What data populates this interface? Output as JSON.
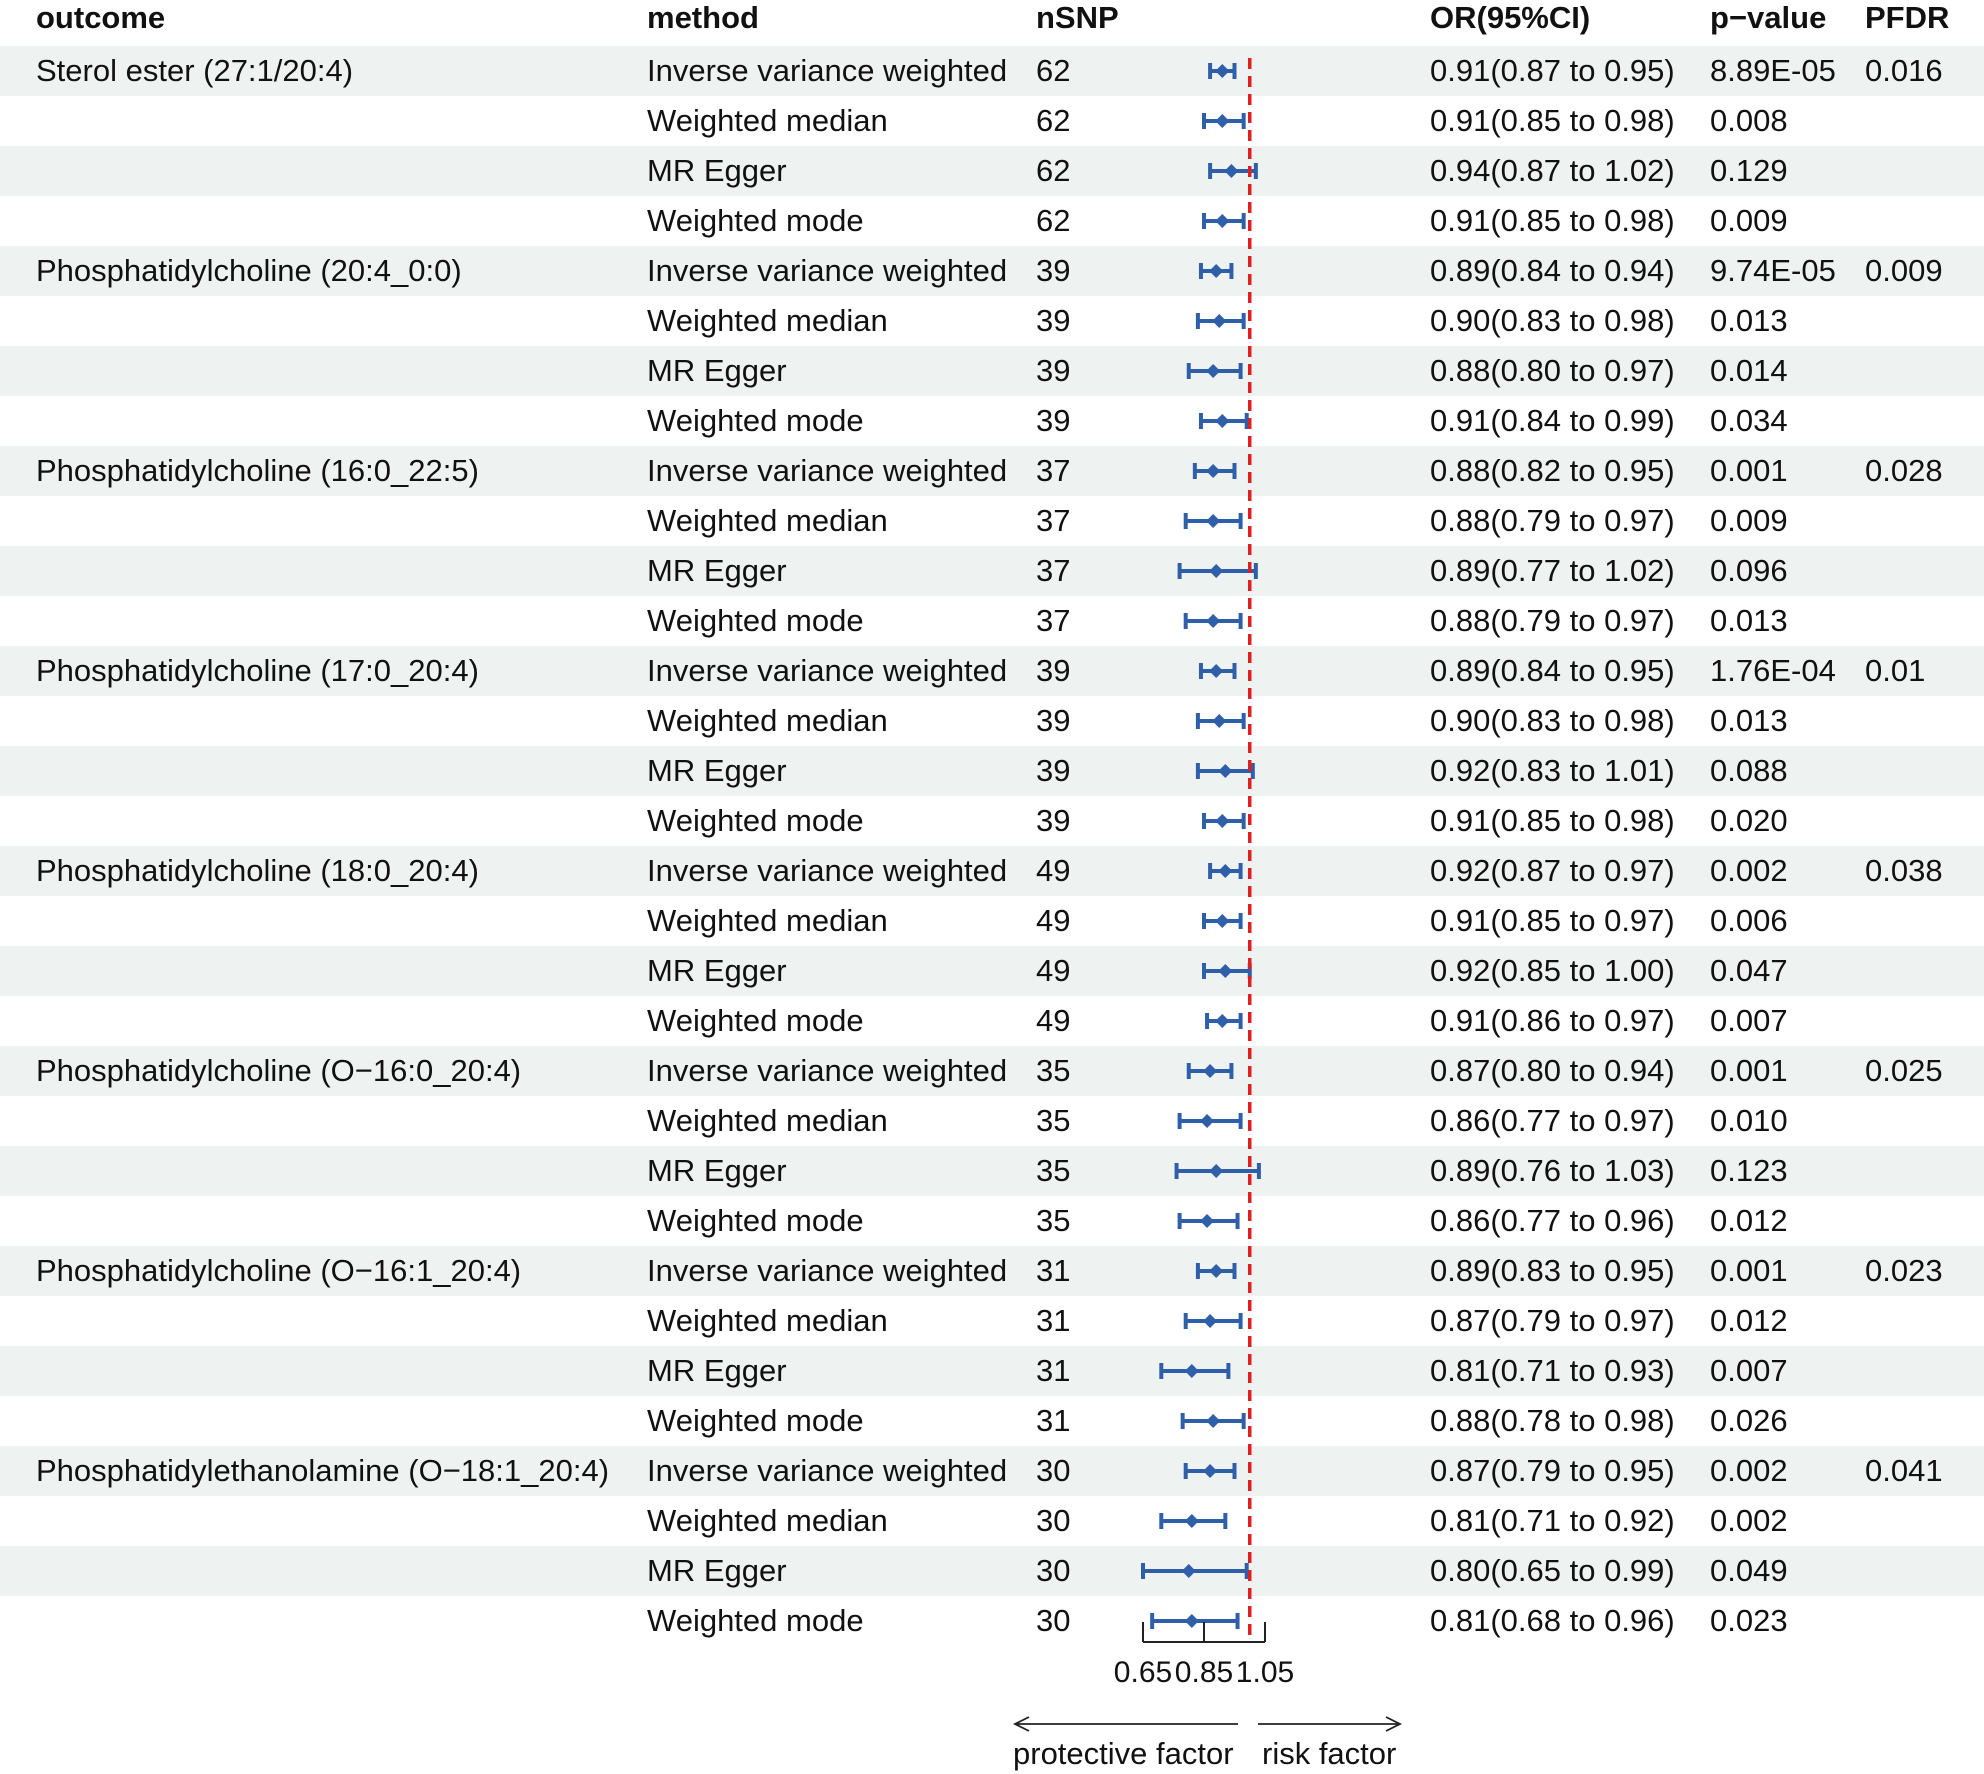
{
  "headers": {
    "outcome": "outcome",
    "method": "method",
    "nsnp": "nSNP",
    "or": "OR(95%CI)",
    "pvalue": "p−value",
    "pfdr": "PFDR"
  },
  "rows": [
    {
      "outcome": "Sterol ester (27:1/20:4)",
      "method": "Inverse variance weighted",
      "nsnp": "62",
      "or_text": "0.91(0.87 to 0.95)",
      "p": "8.89E-05",
      "pfdr": "0.016"
    },
    {
      "outcome": "",
      "method": "Weighted median",
      "nsnp": "62",
      "or_text": "0.91(0.85 to 0.98)",
      "p": "0.008",
      "pfdr": ""
    },
    {
      "outcome": "",
      "method": "MR Egger",
      "nsnp": "62",
      "or_text": "0.94(0.87 to 1.02)",
      "p": "0.129",
      "pfdr": ""
    },
    {
      "outcome": "",
      "method": "Weighted mode",
      "nsnp": "62",
      "or_text": "0.91(0.85 to 0.98)",
      "p": "0.009",
      "pfdr": ""
    },
    {
      "outcome": "Phosphatidylcholine (20:4_0:0)",
      "method": "Inverse variance weighted",
      "nsnp": "39",
      "or_text": "0.89(0.84 to 0.94)",
      "p": "9.74E-05",
      "pfdr": "0.009"
    },
    {
      "outcome": "",
      "method": "Weighted median",
      "nsnp": "39",
      "or_text": "0.90(0.83 to 0.98)",
      "p": "0.013",
      "pfdr": ""
    },
    {
      "outcome": "",
      "method": "MR Egger",
      "nsnp": "39",
      "or_text": "0.88(0.80 to 0.97)",
      "p": "0.014",
      "pfdr": ""
    },
    {
      "outcome": "",
      "method": "Weighted mode",
      "nsnp": "39",
      "or_text": "0.91(0.84 to 0.99)",
      "p": "0.034",
      "pfdr": ""
    },
    {
      "outcome": "Phosphatidylcholine (16:0_22:5)",
      "method": "Inverse variance weighted",
      "nsnp": "37",
      "or_text": "0.88(0.82 to 0.95)",
      "p": "0.001",
      "pfdr": "0.028"
    },
    {
      "outcome": "",
      "method": "Weighted median",
      "nsnp": "37",
      "or_text": "0.88(0.79 to 0.97)",
      "p": "0.009",
      "pfdr": ""
    },
    {
      "outcome": "",
      "method": "MR Egger",
      "nsnp": "37",
      "or_text": "0.89(0.77 to 1.02)",
      "p": "0.096",
      "pfdr": ""
    },
    {
      "outcome": "",
      "method": "Weighted mode",
      "nsnp": "37",
      "or_text": "0.88(0.79 to 0.97)",
      "p": "0.013",
      "pfdr": ""
    },
    {
      "outcome": "Phosphatidylcholine (17:0_20:4)",
      "method": "Inverse variance weighted",
      "nsnp": "39",
      "or_text": "0.89(0.84 to 0.95)",
      "p": "1.76E-04",
      "pfdr": "0.01"
    },
    {
      "outcome": "",
      "method": "Weighted median",
      "nsnp": "39",
      "or_text": "0.90(0.83 to 0.98)",
      "p": "0.013",
      "pfdr": ""
    },
    {
      "outcome": "",
      "method": "MR Egger",
      "nsnp": "39",
      "or_text": "0.92(0.83 to 1.01)",
      "p": "0.088",
      "pfdr": ""
    },
    {
      "outcome": "",
      "method": "Weighted mode",
      "nsnp": "39",
      "or_text": "0.91(0.85 to 0.98)",
      "p": "0.020",
      "pfdr": ""
    },
    {
      "outcome": "Phosphatidylcholine (18:0_20:4)",
      "method": "Inverse variance weighted",
      "nsnp": "49",
      "or_text": "0.92(0.87 to 0.97)",
      "p": "0.002",
      "pfdr": "0.038"
    },
    {
      "outcome": "",
      "method": "Weighted median",
      "nsnp": "49",
      "or_text": "0.91(0.85 to 0.97)",
      "p": "0.006",
      "pfdr": ""
    },
    {
      "outcome": "",
      "method": "MR Egger",
      "nsnp": "49",
      "or_text": "0.92(0.85 to 1.00)",
      "p": "0.047",
      "pfdr": ""
    },
    {
      "outcome": "",
      "method": "Weighted mode",
      "nsnp": "49",
      "or_text": "0.91(0.86 to 0.97)",
      "p": "0.007",
      "pfdr": ""
    },
    {
      "outcome": "Phosphatidylcholine (O−16:0_20:4)",
      "method": "Inverse variance weighted",
      "nsnp": "35",
      "or_text": "0.87(0.80 to 0.94)",
      "p": "0.001",
      "pfdr": "0.025"
    },
    {
      "outcome": "",
      "method": "Weighted median",
      "nsnp": "35",
      "or_text": "0.86(0.77 to 0.97)",
      "p": "0.010",
      "pfdr": ""
    },
    {
      "outcome": "",
      "method": "MR Egger",
      "nsnp": "35",
      "or_text": "0.89(0.76 to 1.03)",
      "p": "0.123",
      "pfdr": ""
    },
    {
      "outcome": "",
      "method": "Weighted mode",
      "nsnp": "35",
      "or_text": "0.86(0.77 to 0.96)",
      "p": "0.012",
      "pfdr": ""
    },
    {
      "outcome": "Phosphatidylcholine (O−16:1_20:4)",
      "method": "Inverse variance weighted",
      "nsnp": "31",
      "or_text": "0.89(0.83 to 0.95)",
      "p": "0.001",
      "pfdr": "0.023"
    },
    {
      "outcome": "",
      "method": "Weighted median",
      "nsnp": "31",
      "or_text": "0.87(0.79 to 0.97)",
      "p": "0.012",
      "pfdr": ""
    },
    {
      "outcome": "",
      "method": "MR Egger",
      "nsnp": "31",
      "or_text": "0.81(0.71 to 0.93)",
      "p": "0.007",
      "pfdr": ""
    },
    {
      "outcome": "",
      "method": "Weighted mode",
      "nsnp": "31",
      "or_text": "0.88(0.78 to 0.98)",
      "p": "0.026",
      "pfdr": ""
    },
    {
      "outcome": "Phosphatidylethanolamine (O−18:1_20:4)",
      "method": "Inverse variance weighted",
      "nsnp": "30",
      "or_text": "0.87(0.79 to 0.95)",
      "p": "0.002",
      "pfdr": "0.041"
    },
    {
      "outcome": "",
      "method": "Weighted median",
      "nsnp": "30",
      "or_text": "0.81(0.71 to 0.92)",
      "p": "0.002",
      "pfdr": ""
    },
    {
      "outcome": "",
      "method": "MR Egger",
      "nsnp": "30",
      "or_text": "0.80(0.65 to 0.99)",
      "p": "0.049",
      "pfdr": ""
    },
    {
      "outcome": "",
      "method": "Weighted mode",
      "nsnp": "30",
      "or_text": "0.81(0.68 to 0.96)",
      "p": "0.023",
      "pfdr": ""
    }
  ],
  "chart_data": {
    "type": "forest",
    "x_ticks": [
      "0.65",
      "0.85",
      "1.05"
    ],
    "xlim": [
      0.65,
      1.05
    ],
    "reference_line": 1,
    "reference_color": "#e02020",
    "mark_color": "#2f5fa8",
    "left_direction_label": "protective factor",
    "right_direction_label": "risk factor",
    "points": [
      {
        "or": 0.91,
        "lo": 0.87,
        "hi": 0.95
      },
      {
        "or": 0.91,
        "lo": 0.85,
        "hi": 0.98
      },
      {
        "or": 0.94,
        "lo": 0.87,
        "hi": 1.02
      },
      {
        "or": 0.91,
        "lo": 0.85,
        "hi": 0.98
      },
      {
        "or": 0.89,
        "lo": 0.84,
        "hi": 0.94
      },
      {
        "or": 0.9,
        "lo": 0.83,
        "hi": 0.98
      },
      {
        "or": 0.88,
        "lo": 0.8,
        "hi": 0.97
      },
      {
        "or": 0.91,
        "lo": 0.84,
        "hi": 0.99
      },
      {
        "or": 0.88,
        "lo": 0.82,
        "hi": 0.95
      },
      {
        "or": 0.88,
        "lo": 0.79,
        "hi": 0.97
      },
      {
        "or": 0.89,
        "lo": 0.77,
        "hi": 1.02
      },
      {
        "or": 0.88,
        "lo": 0.79,
        "hi": 0.97
      },
      {
        "or": 0.89,
        "lo": 0.84,
        "hi": 0.95
      },
      {
        "or": 0.9,
        "lo": 0.83,
        "hi": 0.98
      },
      {
        "or": 0.92,
        "lo": 0.83,
        "hi": 1.01
      },
      {
        "or": 0.91,
        "lo": 0.85,
        "hi": 0.98
      },
      {
        "or": 0.92,
        "lo": 0.87,
        "hi": 0.97
      },
      {
        "or": 0.91,
        "lo": 0.85,
        "hi": 0.97
      },
      {
        "or": 0.92,
        "lo": 0.85,
        "hi": 1.0
      },
      {
        "or": 0.91,
        "lo": 0.86,
        "hi": 0.97
      },
      {
        "or": 0.87,
        "lo": 0.8,
        "hi": 0.94
      },
      {
        "or": 0.86,
        "lo": 0.77,
        "hi": 0.97
      },
      {
        "or": 0.89,
        "lo": 0.76,
        "hi": 1.03
      },
      {
        "or": 0.86,
        "lo": 0.77,
        "hi": 0.96
      },
      {
        "or": 0.89,
        "lo": 0.83,
        "hi": 0.95
      },
      {
        "or": 0.87,
        "lo": 0.79,
        "hi": 0.97
      },
      {
        "or": 0.81,
        "lo": 0.71,
        "hi": 0.93
      },
      {
        "or": 0.88,
        "lo": 0.78,
        "hi": 0.98
      },
      {
        "or": 0.87,
        "lo": 0.79,
        "hi": 0.95
      },
      {
        "or": 0.81,
        "lo": 0.71,
        "hi": 0.92
      },
      {
        "or": 0.8,
        "lo": 0.65,
        "hi": 0.99
      },
      {
        "or": 0.81,
        "lo": 0.68,
        "hi": 0.96
      }
    ]
  }
}
